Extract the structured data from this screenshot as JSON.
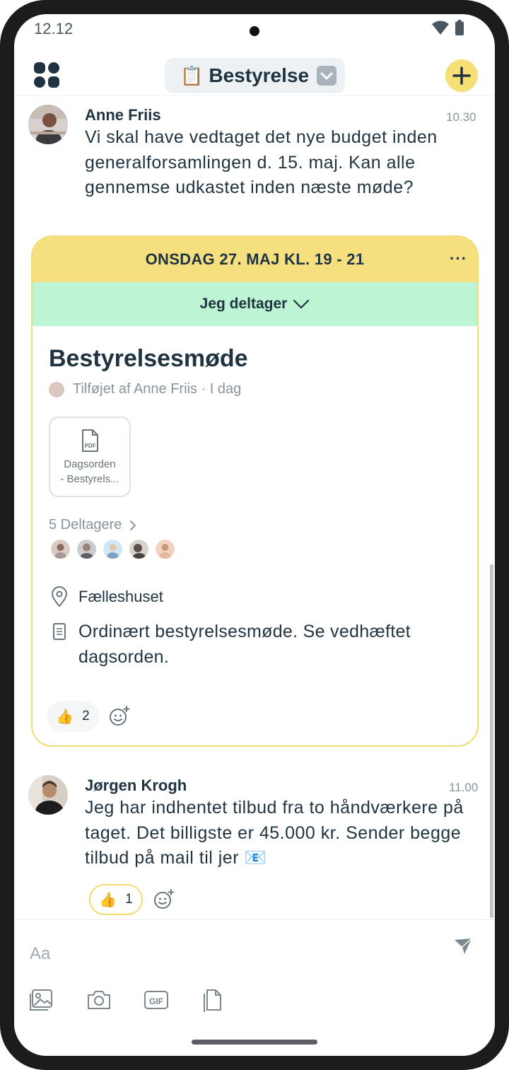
{
  "status_bar": {
    "time": "12.12",
    "icons": [
      "wifi-icon",
      "battery-icon"
    ]
  },
  "header": {
    "menu_icon": "grid-icon",
    "channel_emoji": "📋",
    "channel_title": "Bestyrelse",
    "add_icon": "plus-icon"
  },
  "messages": [
    {
      "author": "Anne Friis",
      "time": "10.30",
      "body": "Vi skal have vedtaget det nye budget inden generalforsamlingen d. 15. maj. Kan alle gennemse udkastet inden næste møde?"
    },
    {
      "author": "Jørgen Krogh",
      "time": "11.00",
      "body": "Jeg har indhentet tilbud fra to håndværkere på taget. Det billigste er 45.000 kr. Sender begge tilbud på mail til jer 📧",
      "reaction": {
        "emoji": "👍",
        "count": "1"
      }
    }
  ],
  "event": {
    "date": "ONSDAG 27. MAJ KL. 19 - 21",
    "more": "···",
    "rsvp": "Jeg deltager",
    "title": "Bestyrelsesmøde",
    "added_by": "Tilføjet af Anne Friis · I dag",
    "attachment": {
      "type": "PDF",
      "name_line1": "Dagsorden",
      "name_line2": "- Bestyrels..."
    },
    "participants_label": "5 Deltagere",
    "participant_count": 5,
    "location": "Fælleshuset",
    "description": "Ordinært bestyrelsesmøde. Se vedhæftet dagsorden.",
    "reaction": {
      "emoji": "👍",
      "count": "2"
    }
  },
  "composer": {
    "placeholder": "Aa",
    "tools": [
      "image-icon",
      "camera-icon",
      "gif-icon",
      "file-icon"
    ]
  },
  "colors": {
    "accent_yellow": "#f6df7f",
    "rsvp_green": "#bdf4d3",
    "text_dark": "#1f3340",
    "text_muted": "#8a949b"
  }
}
